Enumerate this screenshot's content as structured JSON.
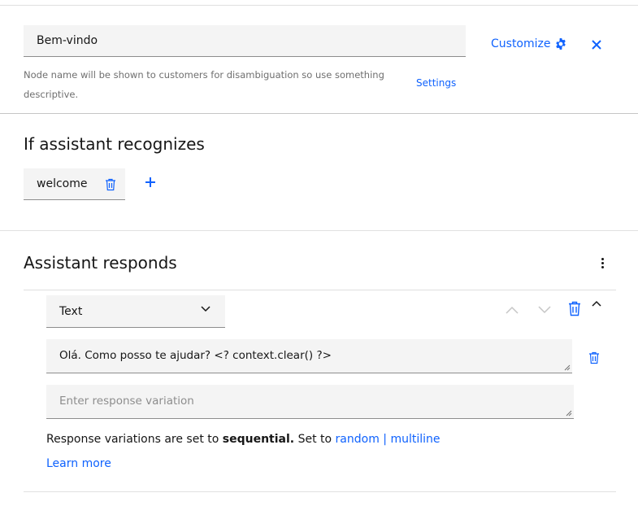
{
  "node": {
    "name_value": "Bem-vindo",
    "helper_text": "Node name will be shown to customers for disambiguation so use something descriptive.",
    "settings_link": "Settings",
    "customize_label": "Customize"
  },
  "recognizes": {
    "heading": "If assistant recognizes",
    "condition": "welcome"
  },
  "responds": {
    "heading": "Assistant responds",
    "response_type": "Text",
    "variations": [
      {
        "value": "Olá. Como posso te ajudar? <? context.clear() ?>"
      }
    ],
    "new_variation_placeholder": "Enter response variation",
    "info_prefix": "Response variations are set to ",
    "info_mode": "sequential.",
    "info_setto": " Set to ",
    "info_random": "random",
    "info_sep": "|",
    "info_multiline": "multiline",
    "learn_more": "Learn more"
  },
  "colors": {
    "accent": "#0f62fe",
    "field_bg": "#f4f4f4",
    "divider": "#e0e0e0",
    "disabled_icon": "#c6c6c6"
  }
}
